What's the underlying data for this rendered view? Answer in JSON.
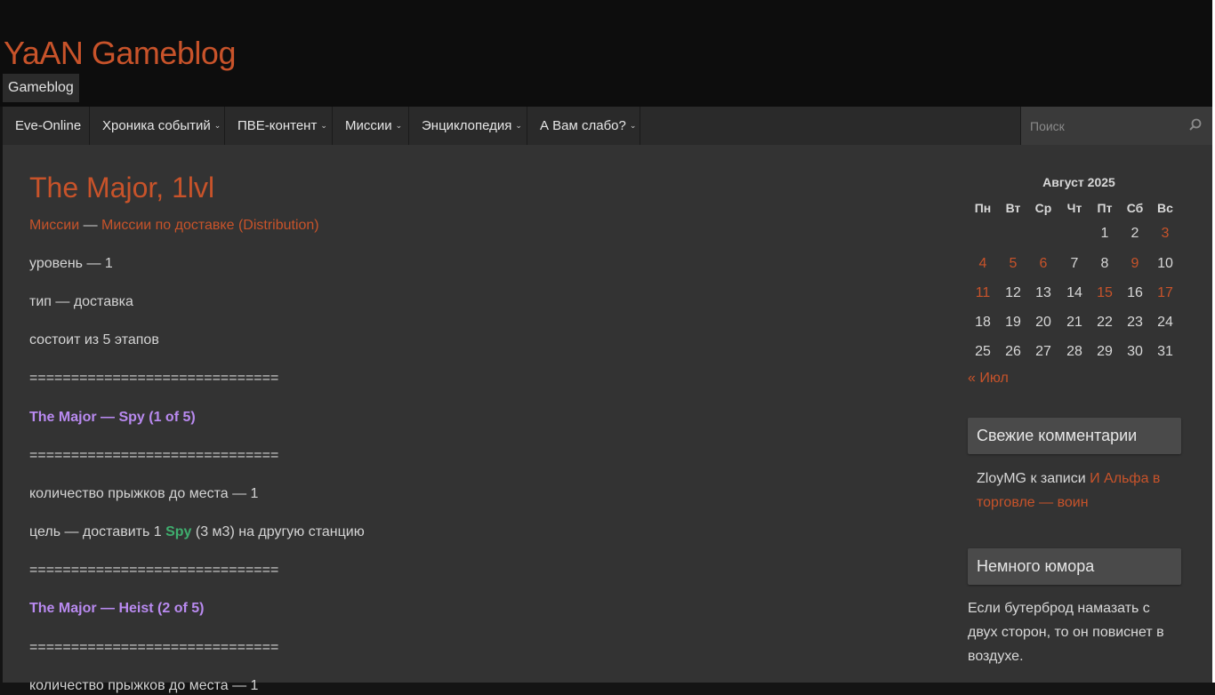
{
  "header": {
    "site_title": "YaAN Gameblog",
    "tagline": "Gameblog"
  },
  "nav": {
    "items": [
      {
        "label": "Eve-Online",
        "has_submenu": false
      },
      {
        "label": "Хроника событий",
        "has_submenu": true
      },
      {
        "label": "ПВЕ-контент",
        "has_submenu": true
      },
      {
        "label": "Миссии",
        "has_submenu": true
      },
      {
        "label": "Энциклопедия",
        "has_submenu": true
      },
      {
        "label": "А Вам слабо?",
        "has_submenu": true
      }
    ],
    "search_placeholder": "Поиск"
  },
  "post": {
    "title": "The Major, 1lvl",
    "category_primary": "Миссии",
    "category_separator": "—",
    "category_secondary": "Миссии по доставке (Distribution)",
    "level": "уровень — 1",
    "type": "тип — доставка",
    "stages": "состоит из 5 этапов",
    "separator": "==============================",
    "stage1_title": "The Major — Spy (1 of 5)",
    "stage1_jumps": "количество прыжков до места — 1",
    "stage1_goal_prefix": "цель — доставить 1 ",
    "stage1_goal_item": "Spy",
    "stage1_goal_suffix": " (3 м3) на другую станцию",
    "stage2_title": "The Major — Heist (2 of 5)",
    "stage2_jumps_partial": "количество прыжков до места — 1"
  },
  "sidebar": {
    "calendar": {
      "caption": "Август 2025",
      "weekdays": [
        "Пн",
        "Вт",
        "Ср",
        "Чт",
        "Пт",
        "Сб",
        "Вс"
      ],
      "weeks": [
        [
          null,
          null,
          null,
          null,
          1,
          2,
          3
        ],
        [
          4,
          5,
          6,
          7,
          8,
          9,
          10
        ],
        [
          11,
          12,
          13,
          14,
          15,
          16,
          17
        ],
        [
          18,
          19,
          20,
          21,
          22,
          23,
          24
        ],
        [
          25,
          26,
          27,
          28,
          29,
          30,
          31
        ]
      ],
      "linked_days": [
        3,
        4,
        5,
        6,
        9,
        11,
        15,
        17
      ],
      "prev_link": "« Июл"
    },
    "recent_comments": {
      "title": "Свежие комментарии",
      "author": "ZloyMG",
      "connector": " к записи ",
      "post_link": "И Альфа в торговле — воин"
    },
    "humor": {
      "title": "Немного юмора",
      "text": "Если бутерброд намазать с двух сторон, то он повиснет в воздухе."
    }
  },
  "colors": {
    "accent": "#c8532a",
    "purple": "#b98af0",
    "green": "#3fae6e",
    "background": "#333333",
    "header_bg": "#0d0d0d"
  }
}
